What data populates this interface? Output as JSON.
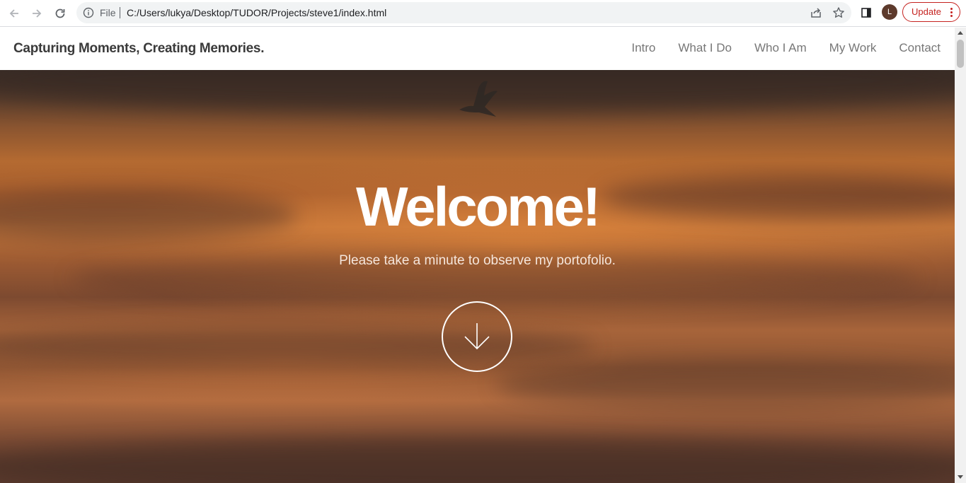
{
  "browser": {
    "scheme_label": "File",
    "url": "C:/Users/lukya/Desktop/TUDOR/Projects/steve1/index.html",
    "profile_initial": "L",
    "update_label": "Update",
    "icons": {
      "back": "arrow-left-icon",
      "forward": "arrow-right-icon",
      "reload": "reload-icon",
      "info": "info-icon",
      "share": "share-icon",
      "bookmark": "star-icon",
      "side_panel": "side-panel-icon",
      "menu": "kebab-menu-icon"
    },
    "colors": {
      "update_accent": "#c5221f",
      "avatar": "#5d3a2c"
    }
  },
  "site": {
    "title": "Capturing Moments, Creating Memories.",
    "nav": [
      {
        "label": "Intro"
      },
      {
        "label": "What I Do"
      },
      {
        "label": "Who I Am"
      },
      {
        "label": "My Work"
      },
      {
        "label": "Contact"
      }
    ]
  },
  "hero": {
    "title": "Welcome!",
    "subtitle": "Please take a minute to observe my portofolio.",
    "scroll_icon": "arrow-down-icon",
    "background": "sunset-sky-photo"
  }
}
